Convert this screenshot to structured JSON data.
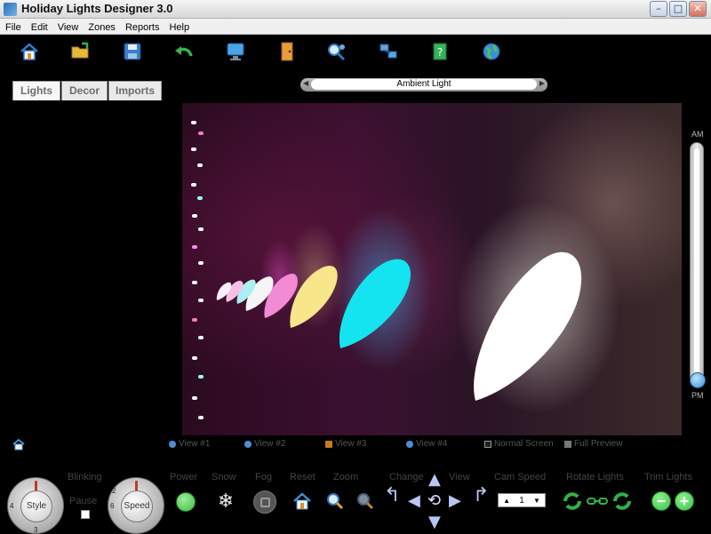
{
  "window": {
    "title": "Holiday Lights Designer 3.0",
    "min_glyph": "–",
    "max_glyph": "□",
    "close_glyph": "✕"
  },
  "menu": [
    "File",
    "Edit",
    "View",
    "Zones",
    "Reports",
    "Help"
  ],
  "toolbar": {
    "icons": [
      "home-icon",
      "open-folder-icon",
      "save-disk-icon",
      "undo-arrow-icon",
      "monitor-icon",
      "door-icon",
      "zoom-people-icon",
      "network-icon",
      "help-book-icon",
      "globe-icon"
    ]
  },
  "tabs": {
    "lights": "Lights",
    "decor": "Decor",
    "imports": "Imports",
    "active": "Lights"
  },
  "ambient": {
    "label": "Ambient Light",
    "left_arrow": "◀",
    "right_arrow": "▶"
  },
  "vertical_slider": {
    "top_label": "AM",
    "bottom_label": "PM"
  },
  "views": {
    "view1": "View #1",
    "view2": "View #2",
    "view3": "View #3",
    "view4": "View #4",
    "normal_screen": "Normal Screen",
    "full_preview": "Full Preview"
  },
  "controls": {
    "blinking": "Blinking",
    "pause": "Pause",
    "power": "Power",
    "snow": "Snow",
    "fog": "Fog",
    "reset": "Reset",
    "zoom": "Zoom",
    "change": "Change",
    "view": "View",
    "cam_speed": "Cam Speed",
    "rotate_lights": "Rotate Lights",
    "trim_lights": "Trim Lights",
    "style_label": "Style",
    "speed_label": "Speed",
    "cam_speed_value": "1",
    "dial_numbers": {
      "n2": "2",
      "n3": "3",
      "n4": "4",
      "n6": "6"
    }
  },
  "colors": {
    "accent_blue": "#3c8fd6",
    "power_green": "#3dbb3d",
    "rotate_green": "#2fb24a",
    "trim_green": "#3ac24a"
  }
}
